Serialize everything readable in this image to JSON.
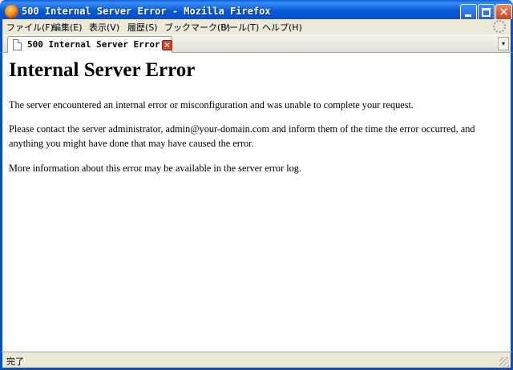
{
  "window": {
    "title": "500 Internal Server Error - Mozilla Firefox",
    "close_glyph": "✕"
  },
  "menu": {
    "items": [
      {
        "label": "ファイル(F)"
      },
      {
        "label": "編集(E)"
      },
      {
        "label": "表示(V)"
      },
      {
        "label": "履歴(S)"
      },
      {
        "label": "ブックマーク(B)"
      },
      {
        "label": "ツール(T)"
      },
      {
        "label": "ヘルプ(H)"
      }
    ]
  },
  "tab": {
    "label": "500 Internal Server Error",
    "close_glyph": "×",
    "list_glyph": "▾"
  },
  "page": {
    "heading": "Internal Server Error",
    "paragraph1": "The server encountered an internal error or misconfiguration and was unable to complete your request.",
    "paragraph2": "Please contact the server administrator, admin@your-domain.com and inform them of the time the error occurred, and anything you might have done that may have caused the error.",
    "paragraph3": "More information about this error may be available in the server error log."
  },
  "status": {
    "text": "完了"
  },
  "icons": {
    "app": "firefox-icon",
    "page": "document-icon",
    "throbber": "throbber-icon"
  },
  "colors": {
    "titlebar": "#0758d6",
    "chrome": "#ece9d8",
    "close_button": "#c8401b"
  }
}
